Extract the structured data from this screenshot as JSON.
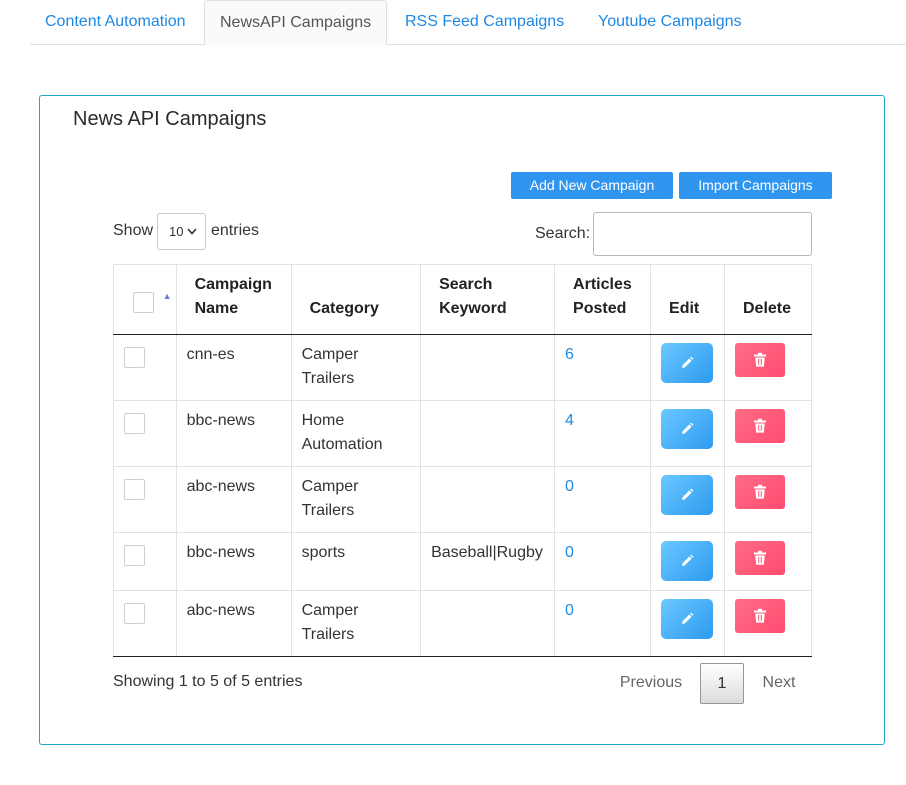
{
  "tabs": [
    {
      "label": "Content Automation"
    },
    {
      "label": "NewsAPI Campaigns"
    },
    {
      "label": "RSS Feed Campaigns"
    },
    {
      "label": "Youtube Campaigns"
    }
  ],
  "active_tab": "NewsAPI Campaigns",
  "card": {
    "title": "News API Campaigns",
    "add_button": "Add New Campaign",
    "import_button": "Import Campaigns"
  },
  "length": {
    "show_label": "Show",
    "selected": "10",
    "entries_label": "entries"
  },
  "search": {
    "label": "Search:",
    "value": "",
    "placeholder": ""
  },
  "table": {
    "columns": [
      {
        "label": ""
      },
      {
        "label": "Campaign Name"
      },
      {
        "label": "Category"
      },
      {
        "label": "Search Keyword"
      },
      {
        "label": "Articles Posted"
      },
      {
        "label": "Edit"
      },
      {
        "label": "Delete"
      }
    ],
    "sorted_column": "select",
    "rows": [
      {
        "name": "cnn-es",
        "category": "Camper Trailers",
        "keyword": "",
        "articles": "6"
      },
      {
        "name": "bbc-news",
        "category": "Home Automation",
        "keyword": "",
        "articles": "4"
      },
      {
        "name": "abc-news",
        "category": "Camper Trailers",
        "keyword": "",
        "articles": "0"
      },
      {
        "name": "bbc-news",
        "category": "sports",
        "keyword": "Baseball|Rugby",
        "articles": "0"
      },
      {
        "name": "abc-news",
        "category": "Camper Trailers",
        "keyword": "",
        "articles": "0"
      }
    ]
  },
  "footer": {
    "info": "Showing 1 to 5 of 5 entries",
    "previous": "Previous",
    "page": "1",
    "next": "Next"
  },
  "icons": {
    "edit": "pencil-icon",
    "delete": "trash-icon",
    "select_chevron": "chevron-down-icon",
    "sort": "sort-arrows-icon"
  },
  "colors": {
    "accent": "#1e88e5",
    "primary_button": "#2f95ee",
    "card_border": "#26a6c7",
    "edit_button": "#3fa9f5",
    "delete_button": "#ff5a78"
  }
}
